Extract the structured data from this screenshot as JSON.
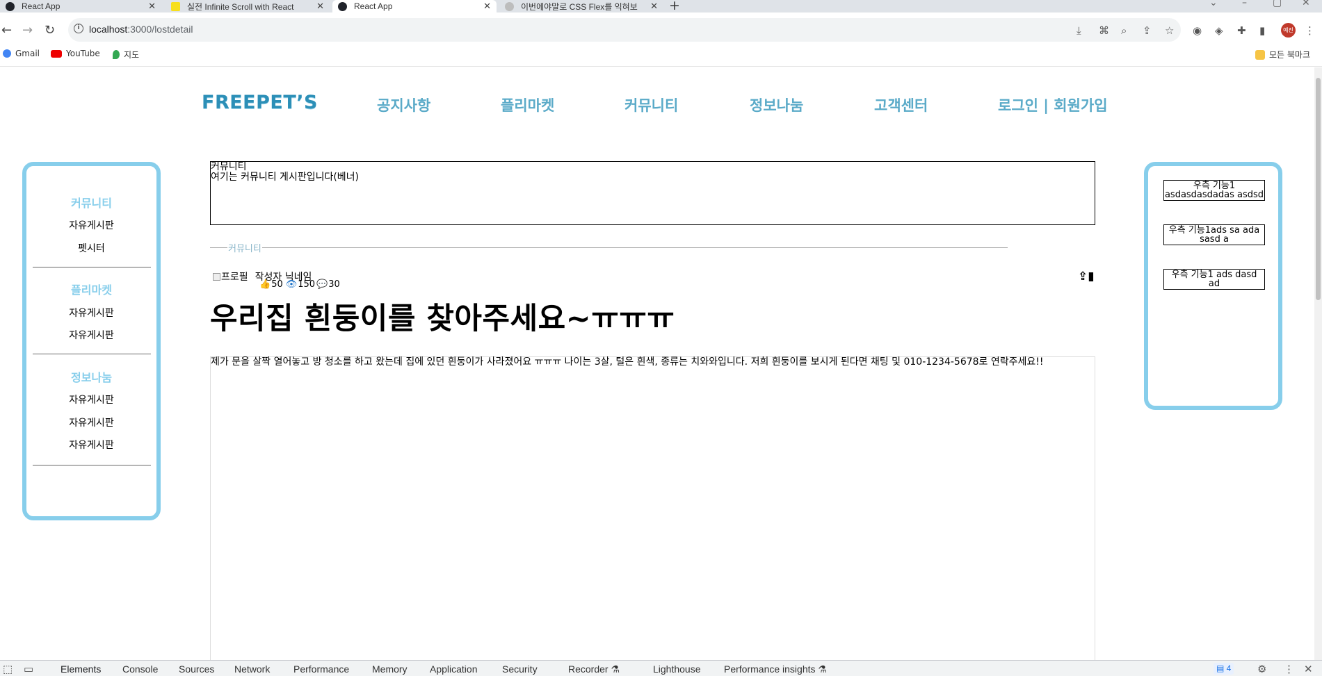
{
  "browser": {
    "tabs": [
      {
        "label": "React App",
        "favicon_color": "#20232a"
      },
      {
        "label": "실전 Infinite Scroll with React",
        "favicon_color": "#f7df1e"
      },
      {
        "label": "React App",
        "favicon_color": "#20232a"
      },
      {
        "label": "이번에야말로 CSS Flex를 익혀보",
        "favicon_color": "#bdbdbd"
      }
    ],
    "new_tab": "+",
    "url_host": "localhost",
    "url_path": ":3000/lostdetail",
    "bookmarks": [
      {
        "label": "Gmail",
        "icon": "google-icon"
      },
      {
        "label": "YouTube",
        "icon": "youtube-icon"
      },
      {
        "label": "지도",
        "icon": "maps-pin-icon"
      }
    ],
    "all_bookmarks": "모든 북마크",
    "profile_initials": "예진"
  },
  "header": {
    "logo": "FREEPET’S",
    "nav": [
      "공지사항",
      "플리마켓",
      "커뮤니티",
      "정보나눔",
      "고객센터",
      "로그인 | 회원가입"
    ]
  },
  "sidebar": {
    "sections": [
      {
        "title": "커뮤니티",
        "items": [
          "자유게시판",
          "펫시터"
        ]
      },
      {
        "title": "플리마켓",
        "items": [
          "자유게시판",
          "자유게시판"
        ]
      },
      {
        "title": "정보나눔",
        "items": [
          "자유게시판",
          "자유게시판",
          "자유게시판"
        ]
      }
    ]
  },
  "banner": {
    "line1": "커뮤니티",
    "line2": "여기는 커뮤니티 게시판입니다(베너)"
  },
  "breadcrumb": "커뮤니티",
  "post": {
    "profile_alt": "프로필",
    "author": "작성자 닉네임",
    "likes": "50",
    "views": "150",
    "comments": "30",
    "title": "우리집 흰둥이를 찾아주세요~ㅠㅠㅠ",
    "body": "제가 문을 살짝 열어놓고 방 청소를 하고 왔는데 집에 있던 흰둥이가 사라졌어요 ㅠㅠㅠ 나이는 3살, 털은 흰색, 종류는 치와와입니다. 저희 흰둥이를 보시게 된다면 채팅 및 010-1234-5678로 연락주세요!!"
  },
  "rightbar": {
    "boxes": [
      {
        "line1": "우측 기능1",
        "line2": "asdasdasdadas asdsd"
      },
      {
        "line1": "우측 기능1ads sa ada",
        "line2": "sasd a"
      },
      {
        "line1": "우측 기능1 ads dasd",
        "line2": "ad"
      }
    ]
  },
  "devtools": {
    "tabs": [
      "Elements",
      "Console",
      "Sources",
      "Network",
      "Performance",
      "Memory",
      "Application",
      "Security",
      "Recorder ⚗",
      "Lighthouse",
      "Performance insights ⚗"
    ],
    "issues_count": "4"
  },
  "colors": {
    "accent": "#87ceeb",
    "nav_text": "#5aaac8",
    "logo": "#2c8fb7"
  }
}
